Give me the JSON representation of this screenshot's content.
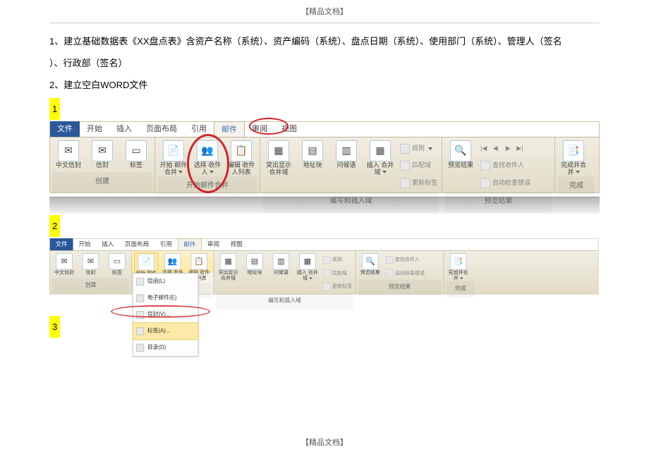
{
  "header": "【精品文档】",
  "footer": "【精品文档】",
  "intro": {
    "line1": "1、建立基础数据表《XX盘点表》含资产名称（系统）、资产编码（系统）、盘点日期（系统）、使用部门（系统）、管理人（签名",
    "line1b": "）、行政部（签名）",
    "line2": "2、建立空白WORD文件"
  },
  "steps": {
    "s1": "1",
    "s2": "2",
    "s3": "3"
  },
  "tabs": {
    "file": "文件",
    "home": "开始",
    "insert": "插入",
    "layout": "页面布局",
    "ref": "引用",
    "mail": "邮件",
    "review": "审阅",
    "view": "视图"
  },
  "grp": {
    "create": "创建",
    "start": "开始邮件合并",
    "write": "编写和插入域",
    "preview": "预览结果",
    "finish": "完成"
  },
  "btn": {
    "cnEnv": "中文信封",
    "env": "信封",
    "label": "标签",
    "startMerge": "开始\n邮件合并",
    "selRecip": "选择\n收件人",
    "editRecip": "编辑\n收件人列表",
    "highlight": "突出显示\n合并域",
    "addrBlock": "地址块",
    "greeting": "问候语",
    "insertField": "插入\n合并域",
    "rules": "规则",
    "match": "匹配域",
    "update": "更新标签",
    "preview": "预览结果",
    "findRecip": "查找收件人",
    "autoErr": "自动检查错误",
    "finish": "完成并合并",
    "first": "|◀",
    "prev": "◀",
    "next": "▶",
    "last": "▶|"
  },
  "dd": {
    "letter": "信函(L)",
    "email": "电子邮件(E)",
    "env": "信封(V)...",
    "label": "标签(A)...",
    "dir": "目录(D)"
  }
}
